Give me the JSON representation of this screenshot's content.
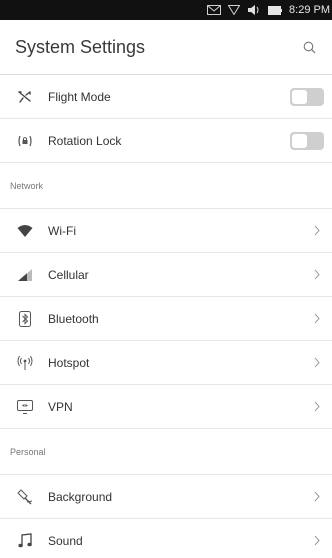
{
  "status_bar": {
    "time": "8:29 PM",
    "icons": [
      "envelope-icon",
      "network-icon",
      "volume-icon",
      "battery-icon"
    ]
  },
  "header": {
    "title": "System Settings",
    "search_icon": "search-icon"
  },
  "quick_toggles": [
    {
      "label": "Flight Mode",
      "icon": "airplane-icon",
      "enabled": false
    },
    {
      "label": "Rotation Lock",
      "icon": "rotation-lock-icon",
      "enabled": false
    }
  ],
  "sections": {
    "network": {
      "title": "Network",
      "items": [
        {
          "label": "Wi-Fi",
          "icon": "wifi-icon"
        },
        {
          "label": "Cellular",
          "icon": "cellular-icon"
        },
        {
          "label": "Bluetooth",
          "icon": "bluetooth-icon"
        },
        {
          "label": "Hotspot",
          "icon": "hotspot-icon"
        },
        {
          "label": "VPN",
          "icon": "vpn-icon"
        }
      ]
    },
    "personal": {
      "title": "Personal",
      "items": [
        {
          "label": "Background",
          "icon": "background-icon"
        },
        {
          "label": "Sound",
          "icon": "sound-icon"
        }
      ]
    }
  },
  "colors": {
    "status_bar_bg": "#111111",
    "toggle_off": "#cfcfcf",
    "divider": "#e6e6e6"
  }
}
